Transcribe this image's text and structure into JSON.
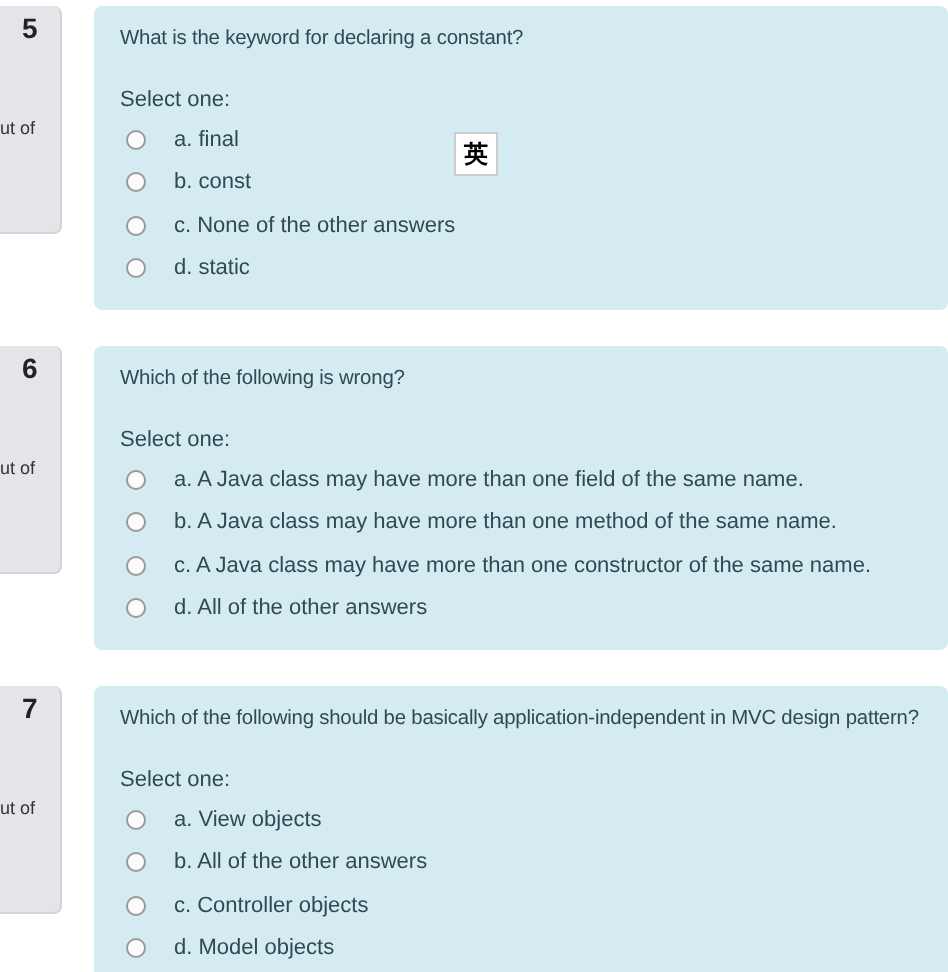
{
  "questions": [
    {
      "number": "5",
      "mark_label": "ut of",
      "text": "What is the keyword for declaring a constant?",
      "prompt": "Select one:",
      "options": [
        {
          "label": "a. final",
          "selected": false
        },
        {
          "label": "b. const",
          "selected": false
        },
        {
          "label": "c. None of the other answers",
          "selected": false
        },
        {
          "label": "d. static",
          "selected": false
        }
      ]
    },
    {
      "number": "6",
      "mark_label": "ut of",
      "text": "Which of the following is wrong?",
      "prompt": "Select one:",
      "options": [
        {
          "label": "a. A Java class may have more than one field of the same name.",
          "selected": false
        },
        {
          "label": "b. A Java class may have more than one method of the same name.",
          "selected": false
        },
        {
          "label": "c. A Java class may have more than one constructor of the same name.",
          "selected": false
        },
        {
          "label": "d. All of the other answers",
          "selected": false
        }
      ]
    },
    {
      "number": "7",
      "mark_label": "ut of",
      "text": "Which of the following should be basically application-independent in MVC design pattern?",
      "prompt": "Select one:",
      "options": [
        {
          "label": "a. View objects",
          "selected": false
        },
        {
          "label": "b. All of the other answers",
          "selected": false
        },
        {
          "label": "c. Controller objects",
          "selected": false
        },
        {
          "label": "d. Model objects",
          "selected": false
        }
      ]
    }
  ],
  "ime_indicator": "英"
}
